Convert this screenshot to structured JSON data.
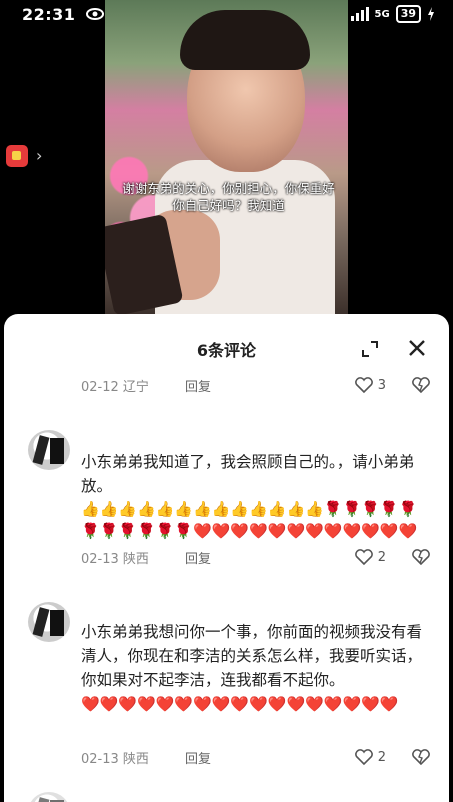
{
  "status_bar": {
    "time": "22:31",
    "battery": "39",
    "network": "5G"
  },
  "video": {
    "subtitle": "谢谢东弟的关心，你别担心，你保重好你自己好吗？我知道"
  },
  "comments_panel": {
    "title": "6条评论",
    "first_meta": {
      "date": "02-12 辽宁",
      "reply": "回复",
      "likes": "3"
    },
    "comments": [
      {
        "text": "小东弟弟我知道了，我会照顾自己的。，请小弟弟放。",
        "emoji_line": "👍👍👍👍👍👍👍👍👍👍👍👍👍🌹🌹🌹🌹🌹🌹🌹🌹🌹🌹🌹❤️❤️❤️❤️❤️❤️❤️❤️❤️❤️❤️❤️",
        "date": "02-13 陕西",
        "reply": "回复",
        "likes": "2"
      },
      {
        "text": "小东弟弟我想问你一个事，你前面的视频我没有看清人，你现在和李洁的关系怎么样，我要听实话，你如果对不起李洁，连我都看不起你。",
        "emoji_line": "❤️❤️❤️❤️❤️❤️❤️❤️❤️❤️❤️❤️❤️❤️❤️❤️❤️",
        "date": "02-13 陕西",
        "reply": "回复",
        "likes": "2"
      }
    ]
  },
  "colors": {
    "accent_red": "#e8412e",
    "meta_gray": "#888888"
  }
}
